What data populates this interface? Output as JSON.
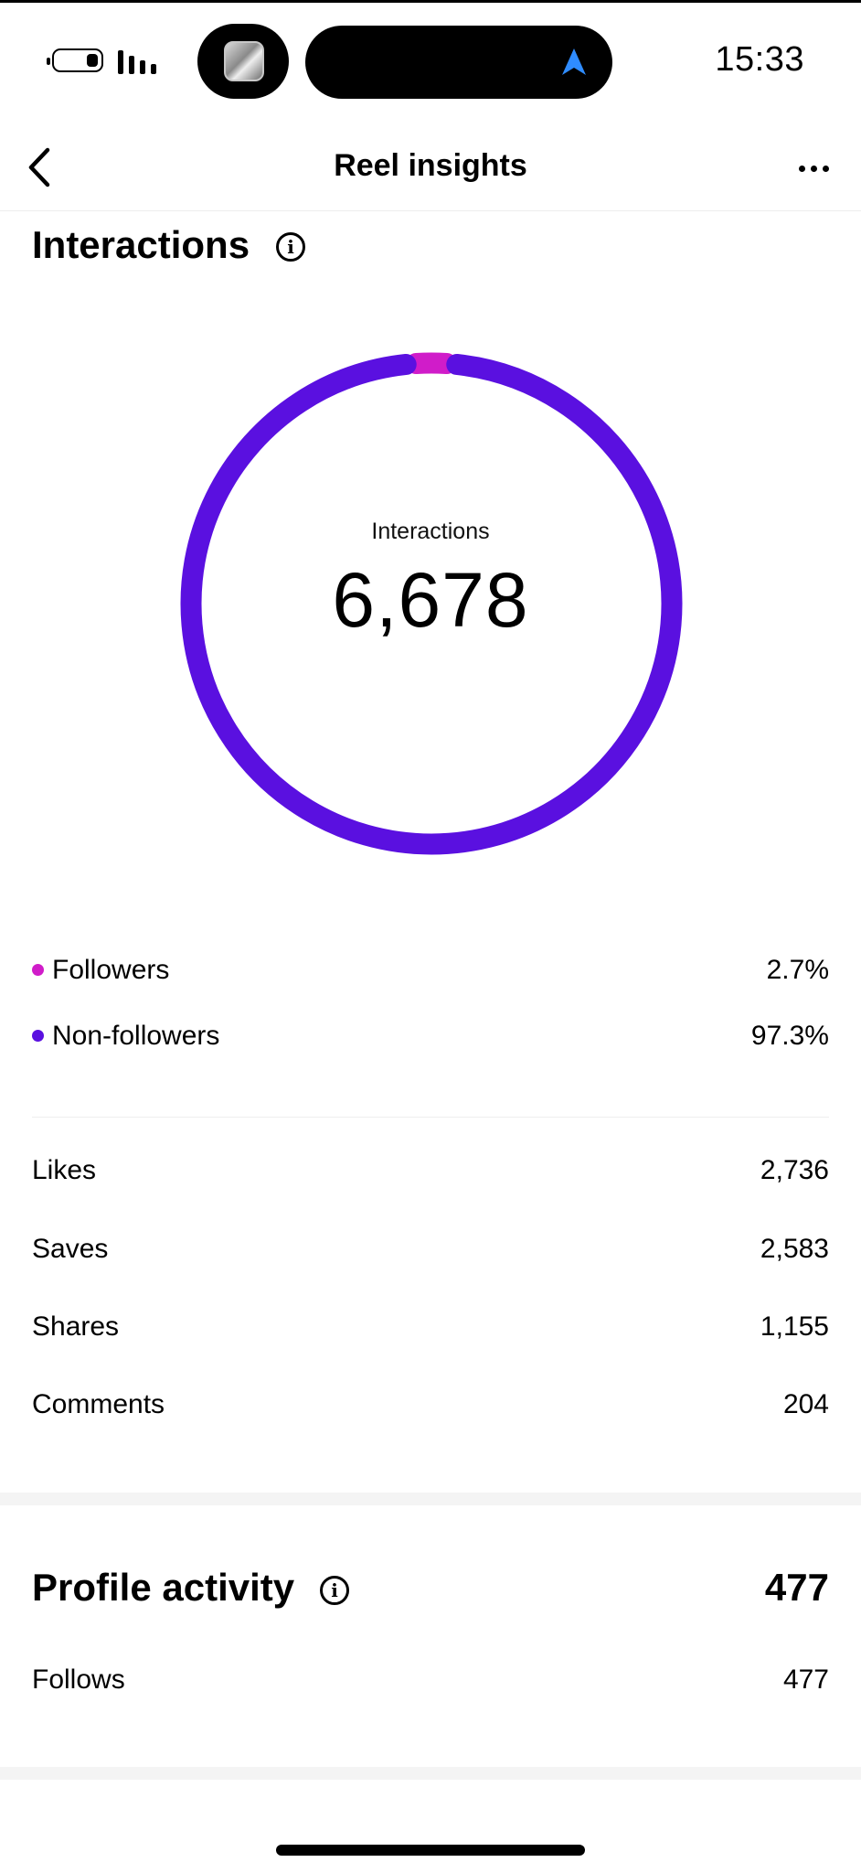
{
  "status_bar": {
    "time": "15:33",
    "battery_icon": "battery-icon",
    "signal_icon": "signal-bars-icon",
    "navigation_icon": "location-arrow-icon",
    "app_thumbnail_icon": "app-thumbnail-icon"
  },
  "header": {
    "title": "Reel insights",
    "back_icon": "chevron-left-icon",
    "more_icon": "more-dots-icon"
  },
  "interactions": {
    "title": "Interactions",
    "info_icon": "info-icon",
    "center_label": "Interactions",
    "total": "6,678",
    "legend": [
      {
        "label": "Followers",
        "value": "2.7%",
        "color": "#d01cc9"
      },
      {
        "label": "Non-followers",
        "value": "97.3%",
        "color": "#5a10e0"
      }
    ],
    "metrics": [
      {
        "label": "Likes",
        "value": "2,736"
      },
      {
        "label": "Saves",
        "value": "2,583"
      },
      {
        "label": "Shares",
        "value": "1,155"
      },
      {
        "label": "Comments",
        "value": "204"
      }
    ]
  },
  "chart_data": {
    "type": "pie",
    "categories": [
      "Followers",
      "Non-followers"
    ],
    "values": [
      2.7,
      97.3
    ],
    "colors": [
      "#d01cc9",
      "#5a10e0"
    ],
    "title": "",
    "center_text": "Interactions 6,678",
    "legend_placement": "bottom"
  },
  "profile_activity": {
    "title": "Profile activity",
    "info_icon": "info-icon",
    "total": "477",
    "metrics": [
      {
        "label": "Follows",
        "value": "477"
      }
    ]
  }
}
